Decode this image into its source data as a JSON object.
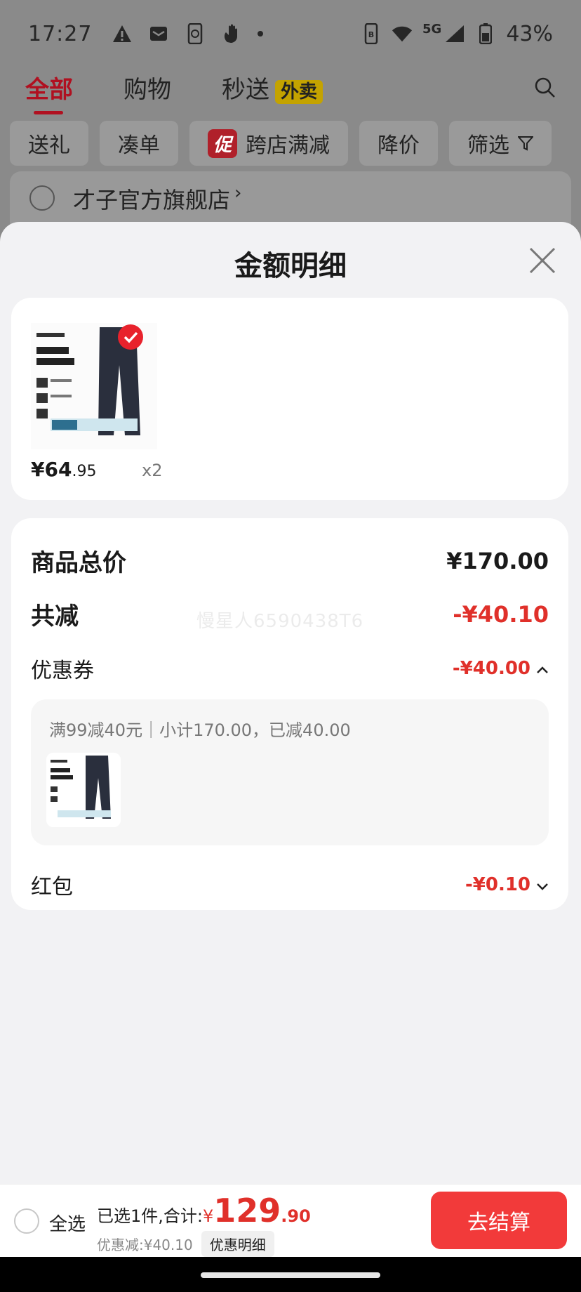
{
  "status_bar": {
    "time": "17:27",
    "network": "5G",
    "battery": "43%"
  },
  "background": {
    "tabs": [
      {
        "label": "全部"
      },
      {
        "label": "购物"
      },
      {
        "label": "秒送"
      }
    ],
    "waimai_badge": "外卖",
    "chips": [
      {
        "label": "送礼"
      },
      {
        "label": "凑单"
      },
      {
        "label": "跨店满减"
      },
      {
        "label": "降价"
      },
      {
        "label": "筛选"
      }
    ],
    "cu_badge": "促",
    "store_name": "才子官方旗舰店",
    "store_chevron": "›"
  },
  "sheet": {
    "title": "金额明细",
    "product": {
      "price_int": "¥64",
      "price_dec": ".95",
      "qty": "x2"
    },
    "rows": {
      "total_label": "商品总价",
      "total_value": "¥170.00",
      "reduce_label": "共减",
      "reduce_value": "-¥40.10",
      "coupon_label": "优惠券",
      "coupon_value": "-¥40.00",
      "redpack_label": "红包",
      "redpack_value": "-¥0.10"
    },
    "coupon_detail": "满99减40元｜小计170.00，已减40.00",
    "watermark": "慢星人6590438T6"
  },
  "bottom_bar": {
    "select_all": "全选",
    "summary_prefix": "已选1件,合计:",
    "total_yen": "¥",
    "total_int": "129",
    "total_dec": ".90",
    "discount_text": "优惠减:¥40.10",
    "detail_chip": "优惠明细",
    "checkout": "去结算"
  },
  "colors": {
    "accent_red": "#e0302a",
    "button_red": "#f23a3a",
    "sheet_bg": "#f2f2f4"
  }
}
